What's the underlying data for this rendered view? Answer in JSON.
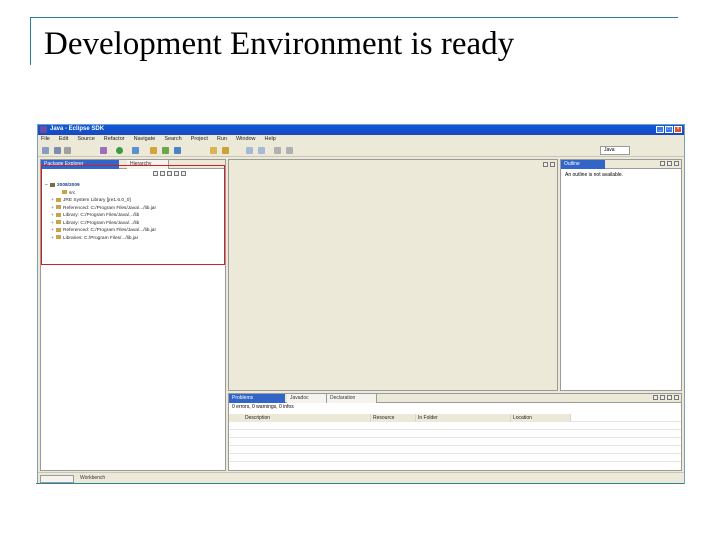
{
  "slide": {
    "title": "Development Environment is ready"
  },
  "window": {
    "title": "Java - Eclipse SDK",
    "menus": [
      "File",
      "Edit",
      "Source",
      "Refactor",
      "Navigate",
      "Search",
      "Project",
      "Run",
      "Window",
      "Help"
    ],
    "perspective": "Java"
  },
  "package_explorer": {
    "tabs": [
      "Package Explorer",
      "Hierarchy"
    ],
    "tree": [
      {
        "label": "2008/2009",
        "expander": "−",
        "root": true
      },
      {
        "label": "src",
        "expander": ""
      },
      {
        "label": "JRE System Library [jre1.6.0_0]",
        "expander": "+"
      },
      {
        "label": "Referenced: C:/Program Files/Java/.../lib.jar",
        "expander": "+"
      },
      {
        "label": "Library: C:/Program Files/Java/.../lib",
        "expander": "+"
      },
      {
        "label": "Library: C:/Program Files/Java/.../lib",
        "expander": "+"
      },
      {
        "label": "Referenced: C:/Program Files/Java/.../lib.jar",
        "expander": "+"
      },
      {
        "label": "Libraries: C:/Program Files/.../lib.jar",
        "expander": "+"
      }
    ]
  },
  "outline": {
    "tab": "Outline",
    "message": "An outline is not available."
  },
  "problems": {
    "tabs": [
      "Problems",
      "Javadoc",
      "Declaration"
    ],
    "summary": "0 errors, 0 warnings, 0 infos",
    "columns": [
      "Description",
      "Resource",
      "In Folder",
      "Location"
    ]
  },
  "status": {
    "text": "Workbench"
  },
  "colors": {
    "accent": "#2e7ea0",
    "highlight_border": "#d21e2c",
    "active_tab": "#3165c7",
    "titlebar": "#0a5ae0"
  }
}
